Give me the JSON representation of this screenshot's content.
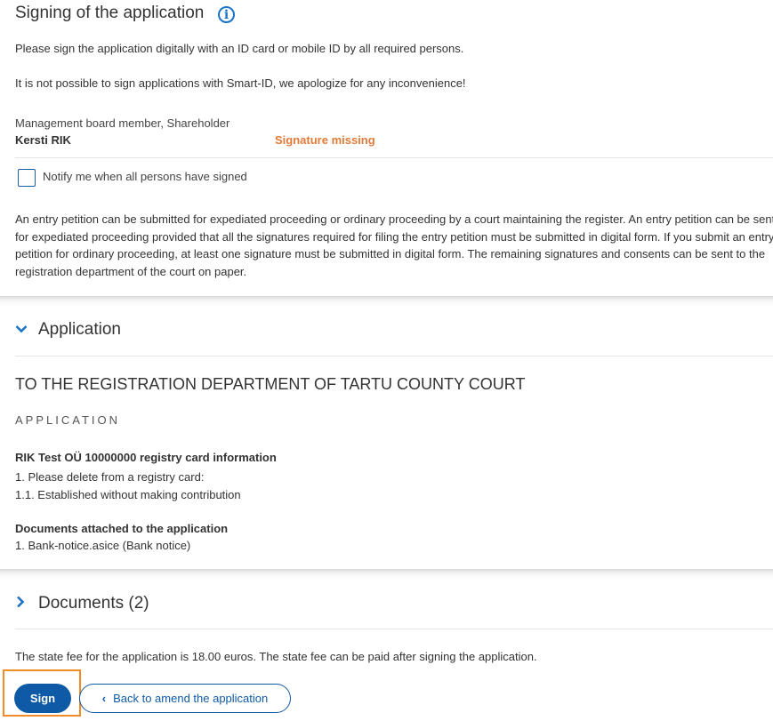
{
  "signing": {
    "title": "Signing of the application",
    "info_icon": "i",
    "intro": "Please sign the application digitally with an ID card or mobile ID by all required persons.",
    "smartid_note": "It is not possible to sign applications with Smart-ID, we apologize for any inconvenience!",
    "signer": {
      "roles": "Management board member, Shareholder",
      "name": "Kersti RIK",
      "status": "Signature missing"
    },
    "notify_label": "Notify me when all persons have signed",
    "notify_checked": false,
    "explanation": "An entry petition can be submitted for expediated proceeding or ordinary proceeding by a court maintaining the register. An entry petition can be sent for expediated proceeding provided that all the signatures required for filing the entry petition must be submitted in digital form. If you submit an entry petition for ordinary proceeding, at least one signature must be submitted in digital form. The remaining signatures and consents can be sent to the registration department of the court on paper."
  },
  "application_section": {
    "header": "Application",
    "expanded": true,
    "court": "TO THE REGISTRATION DEPARTMENT OF TARTU COUNTY COURT",
    "doc_type": "APPLICATION",
    "registry_title": "RIK Test OÜ 10000000 registry card information",
    "registry_lines": [
      "1. Please delete from a registry card:",
      "1.1. Established without making contribution"
    ],
    "attachments_title": "Documents attached to the application",
    "attachments": [
      "1. Bank-notice.asice (Bank notice)"
    ]
  },
  "documents_section": {
    "header": "Documents (2)",
    "expanded": false
  },
  "fee_text": "The state fee for the application is 18.00 euros. The state fee can be paid after signing the application.",
  "actions": {
    "sign_label": "Sign",
    "back_label": "Back to amend the application"
  },
  "colors": {
    "primary": "#0f5aa6",
    "link_blue": "#1a73c7",
    "warning": "#e07b39",
    "focus": "#f28c28"
  }
}
